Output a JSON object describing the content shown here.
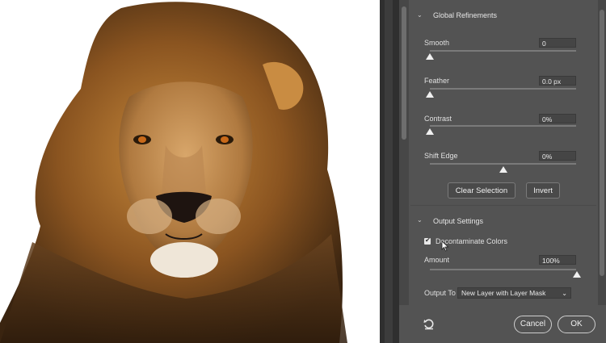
{
  "global_refinements": {
    "title": "Global Refinements",
    "smooth": {
      "label": "Smooth",
      "value": "0",
      "level": 0
    },
    "feather": {
      "label": "Feather",
      "value": "0.0 px",
      "level": 0
    },
    "contrast": {
      "label": "Contrast",
      "value": "0%",
      "level": 0
    },
    "shift_edge": {
      "label": "Shift Edge",
      "value": "0%",
      "level": 0.5
    },
    "clear_selection_label": "Clear Selection",
    "invert_label": "Invert"
  },
  "output_settings": {
    "title": "Output Settings",
    "decontaminate_label": "Decontaminate Colors",
    "decontaminate_checked": true,
    "amount": {
      "label": "Amount",
      "value": "100%",
      "level": 1
    },
    "output_to_label": "Output To",
    "output_to_value": "New Layer with Layer Mask"
  },
  "footer": {
    "cancel_label": "Cancel",
    "ok_label": "OK"
  },
  "icons": {
    "reset": "reset-icon",
    "chevron": "chevron-down-icon",
    "cursor": "cursor-icon"
  }
}
